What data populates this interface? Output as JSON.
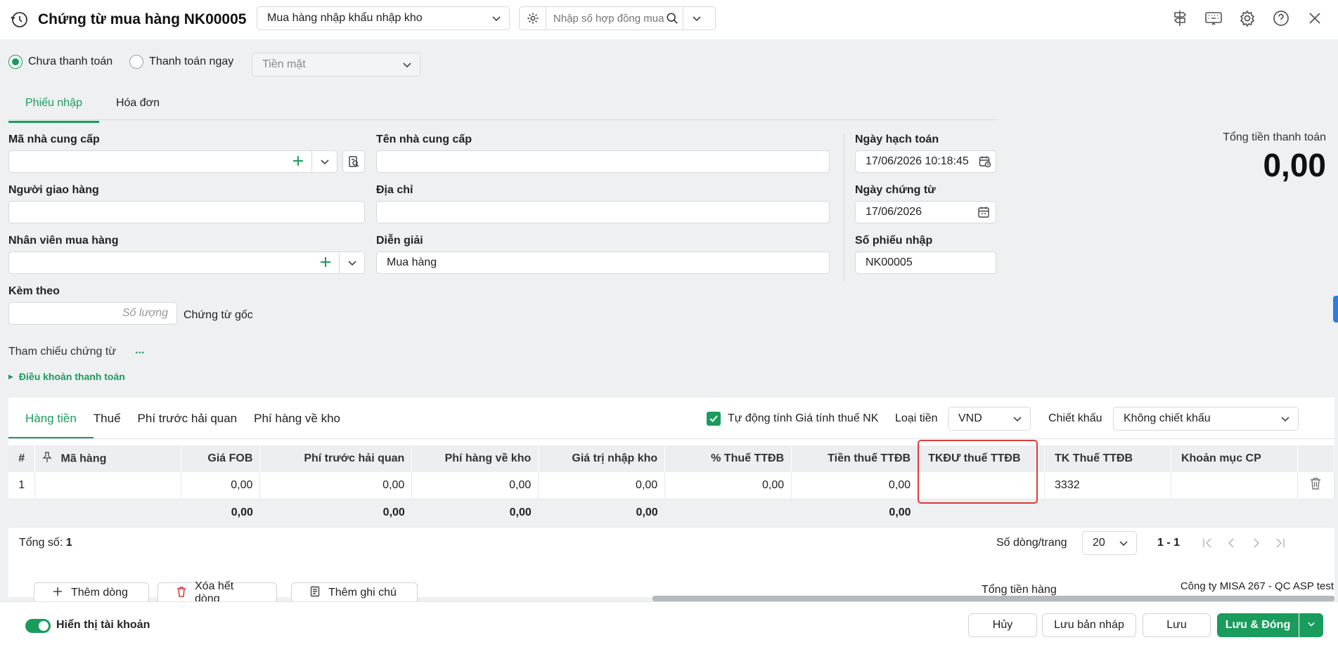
{
  "header": {
    "title": "Chứng từ mua hàng NK00005",
    "type_select": "Mua hàng nhập khẩu nhập kho",
    "contract_placeholder": "Nhập số hợp đồng mua"
  },
  "payment": {
    "option_unpaid": "Chưa thanh toán",
    "option_pay_now": "Thanh toán ngay",
    "method": "Tiền mặt"
  },
  "top_tabs": [
    "Phiếu nhập",
    "Hóa đơn"
  ],
  "form": {
    "supplier_code_label": "Mã nhà cung cấp",
    "supplier_name_label": "Tên nhà cung cấp",
    "deliverer_label": "Người giao hàng",
    "address_label": "Địa chỉ",
    "buyer_label": "Nhân viên mua hàng",
    "description_label": "Diễn giải",
    "description_value": "Mua hàng",
    "attach_label": "Kèm theo",
    "quantity_placeholder": "Số lượng",
    "original_docs": "Chứng từ gốc",
    "reference_label": "Tham chiếu chứng từ",
    "reference_more": "...",
    "payment_terms": "Điều khoản thanh toán",
    "posting_date_label": "Ngày hạch toán",
    "posting_date_value": "17/06/2026 10:18:45",
    "doc_date_label": "Ngày chứng từ",
    "doc_date_value": "17/06/2026",
    "receipt_no_label": "Số phiếu nhập",
    "receipt_no_value": "NK00005"
  },
  "total": {
    "label": "Tổng tiền thanh toán",
    "value": "0,00"
  },
  "detail_tabs": [
    "Hàng tiền",
    "Thuế",
    "Phí trước hải quan",
    "Phí hàng về kho"
  ],
  "options": {
    "auto_calc_label": "Tự động tính Giá tính thuế NK",
    "currency_label": "Loại tiền",
    "currency_value": "VND",
    "discount_label": "Chiết khấu",
    "discount_value": "Không chiết khấu"
  },
  "grid": {
    "headers": [
      "#",
      "Mã hàng",
      "Giá FOB",
      "Phí trước hải quan",
      "Phí hàng về kho",
      "Giá trị nhập kho",
      "% Thuế TTĐB",
      "Tiền thuế TTĐB",
      "TKĐƯ thuế TTĐB",
      "TK Thuế TTĐB",
      "Khoản mục CP"
    ],
    "row": {
      "index": "1",
      "item_code": "",
      "fob": "0,00",
      "pre_customs_fee": "0,00",
      "warehouse_fee": "0,00",
      "stock_value": "0,00",
      "excise_rate": "0,00",
      "excise_amount": "0,00",
      "excise_contra_account": "",
      "excise_account": "3332",
      "cost_item": ""
    },
    "totals": {
      "fob": "0,00",
      "pre_customs_fee": "0,00",
      "warehouse_fee": "0,00",
      "stock_value": "0,00",
      "excise_amount": "0,00"
    }
  },
  "pager": {
    "total_label": "Tổng số:",
    "total_value": "1",
    "rows_per_page_label": "Số dòng/trang",
    "rows_per_page": "20",
    "range": "1 - 1"
  },
  "bottom": {
    "add_row": "Thêm dòng",
    "delete_all": "Xóa hết dòng",
    "add_note": "Thêm ghi chú",
    "goods_total": "Tổng tiền hàng",
    "company": "Công ty MISA 267 - QC ASP test"
  },
  "footer": {
    "show_account": "Hiển thị tài khoản",
    "cancel": "Hủy",
    "save_draft": "Lưu bản nháp",
    "save": "Lưu",
    "save_close": "Lưu & Đóng"
  },
  "colors": {
    "accent": "#1a9c5c",
    "highlight": "#e03a3a"
  }
}
